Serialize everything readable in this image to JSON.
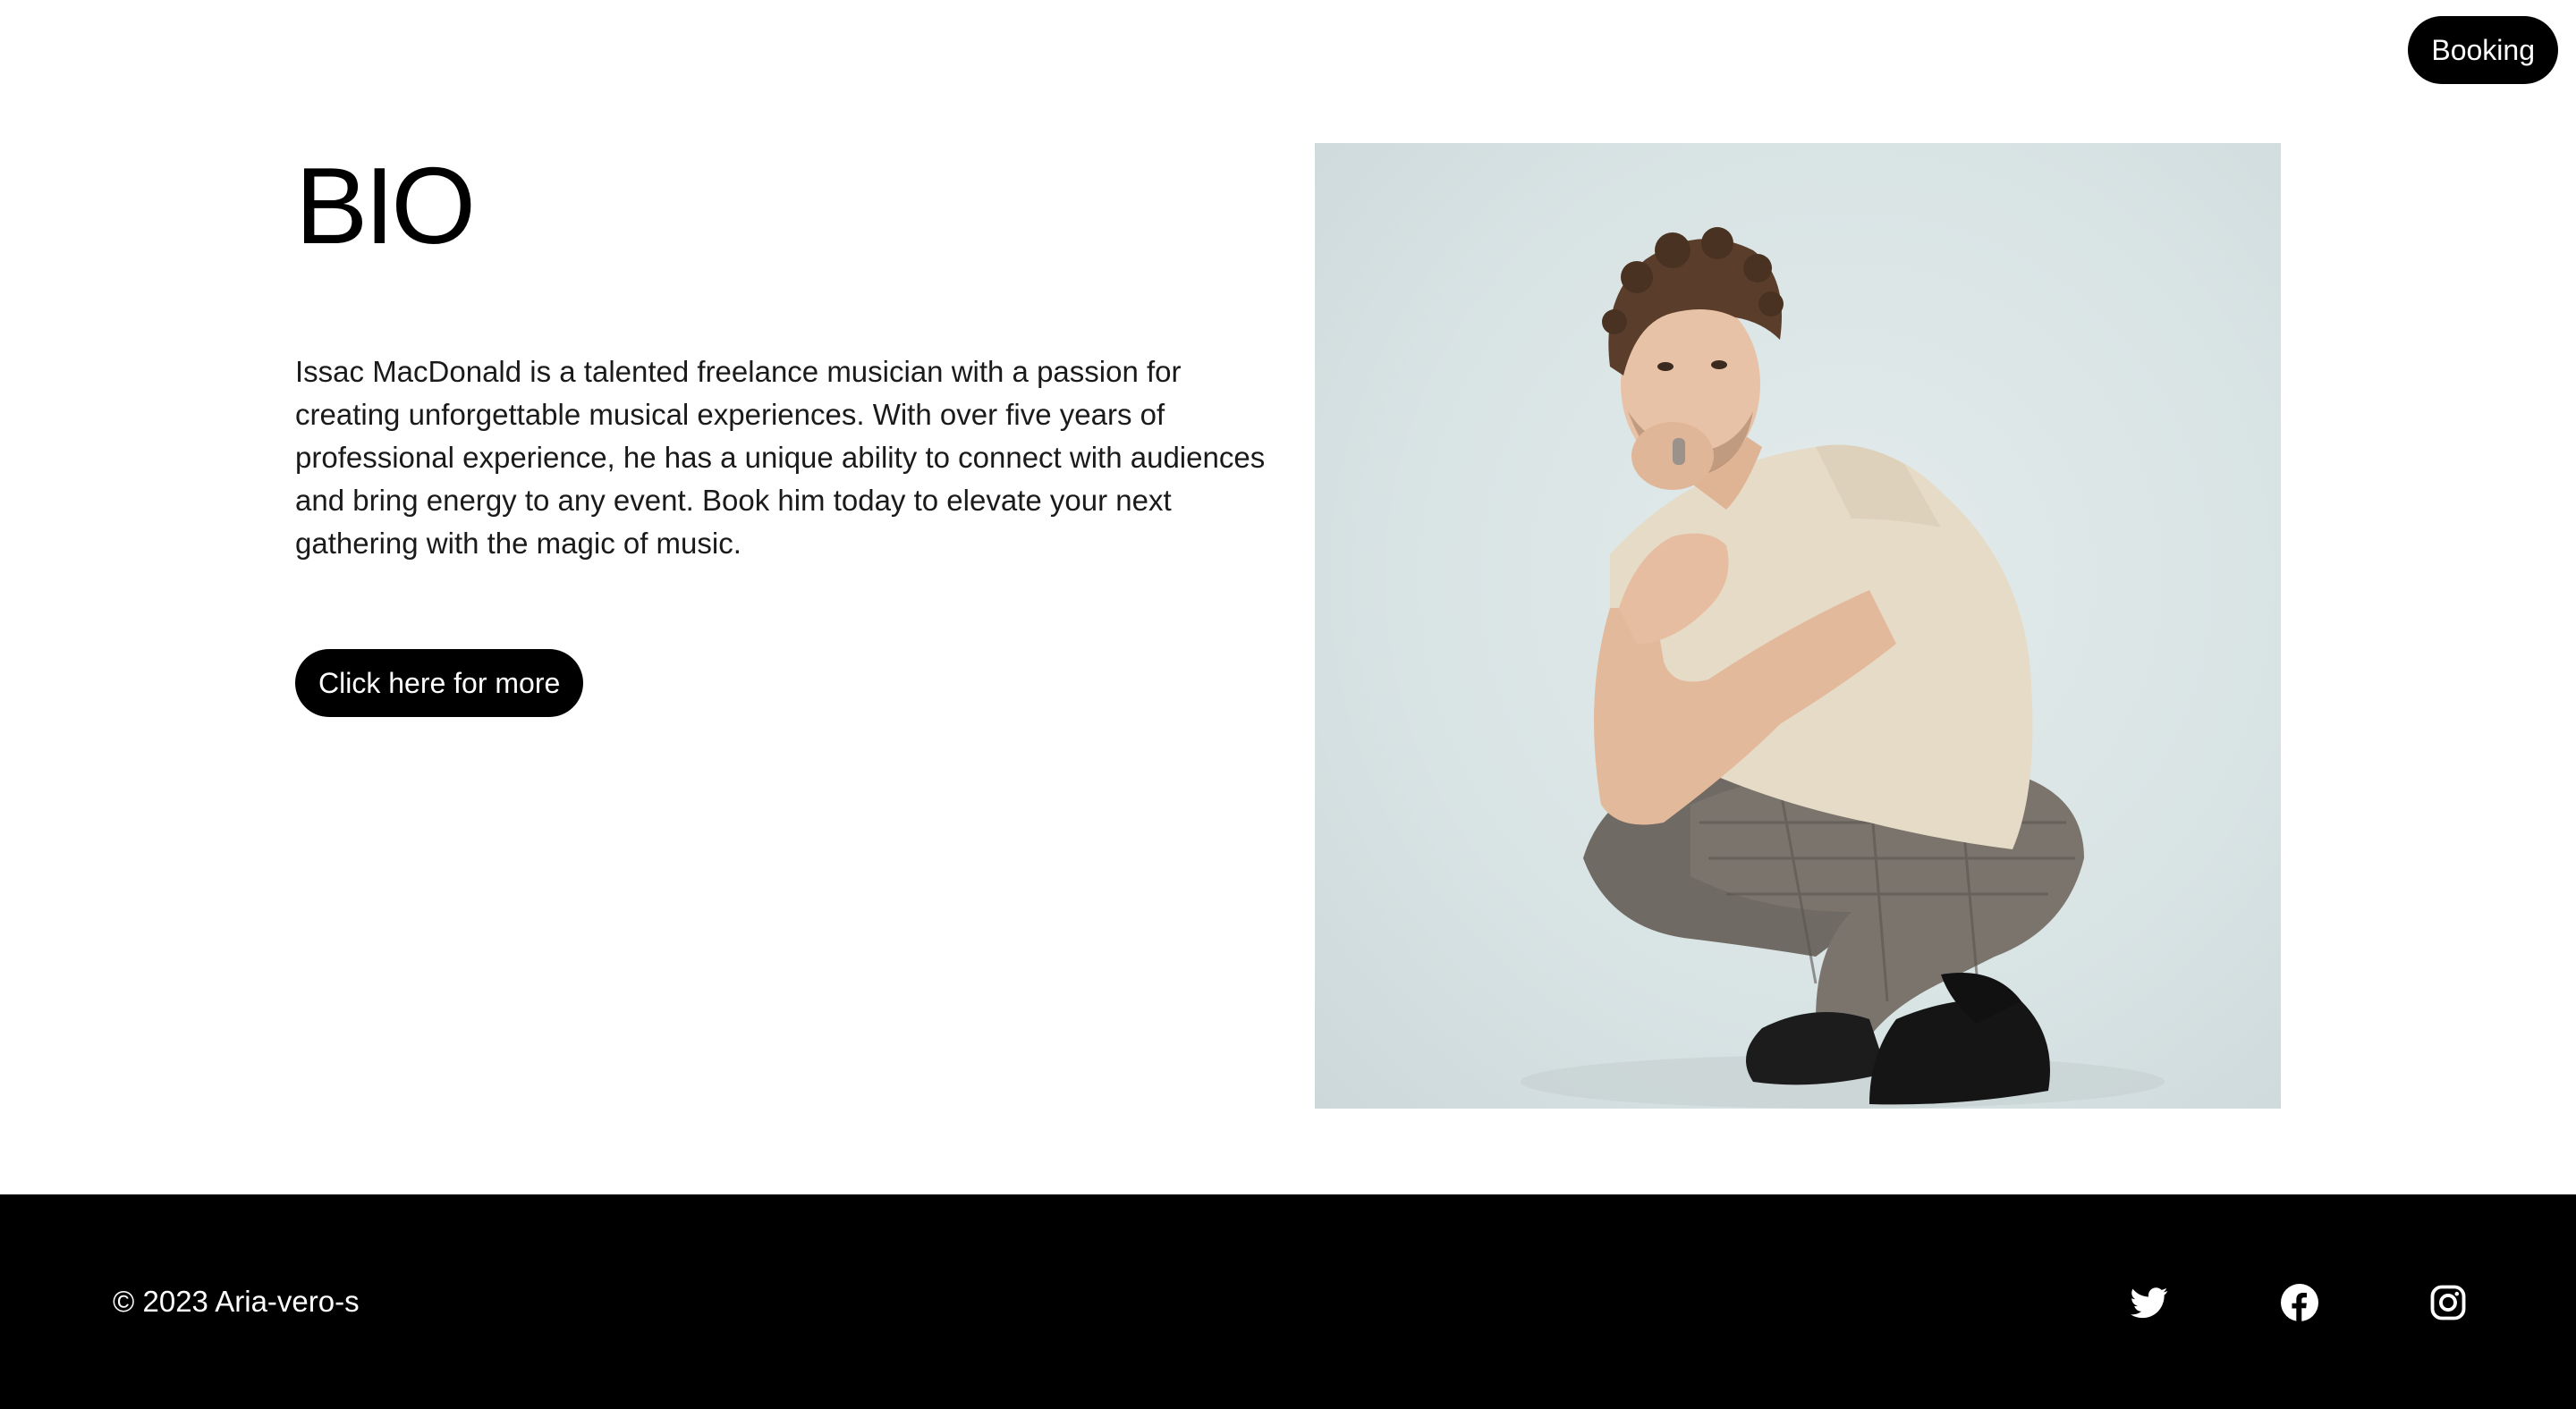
{
  "header": {
    "booking_label": "Booking"
  },
  "bio": {
    "title": "BIO",
    "text": "Issac MacDonald is a talented freelance musician with a passion for creating unforgettable musical experiences. With over five years of professional experience, he has a unique ability to connect with audiences and bring energy to any event. Book him today to elevate your next gathering with the magic of music.",
    "more_label": "Click here for more"
  },
  "photo": {
    "icon": "portrait-photo"
  },
  "footer": {
    "copyright": "© 2023 Aria-vero-s",
    "social": [
      {
        "icon": "twitter-icon"
      },
      {
        "icon": "facebook-icon"
      },
      {
        "icon": "instagram-icon"
      }
    ]
  },
  "colors": {
    "button_bg": "#000000",
    "button_text": "#ffffff",
    "footer_bg": "#000000",
    "page_bg": "#ffffff",
    "photo_bg": "#dbe5e6"
  }
}
